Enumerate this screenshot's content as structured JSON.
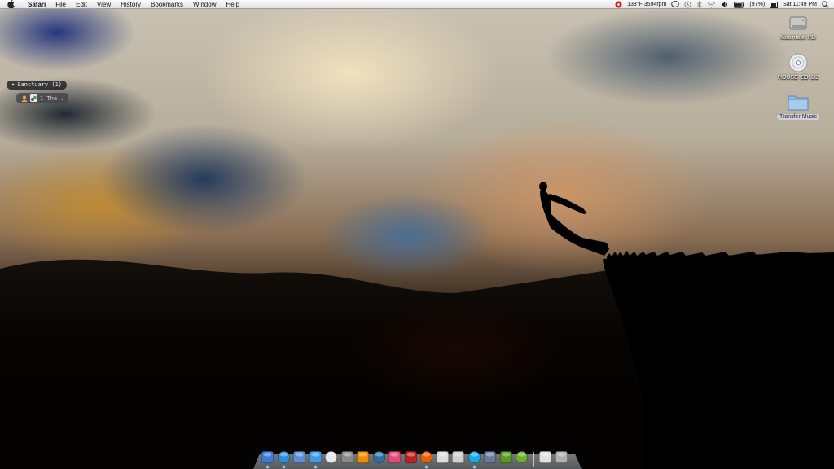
{
  "menubar": {
    "app_name": "Safari",
    "menus": [
      "File",
      "Edit",
      "View",
      "History",
      "Bookmarks",
      "Window",
      "Help"
    ],
    "status": {
      "temp_fan": "138°F 3594rpm",
      "battery": "(97%)",
      "clock": "Sat 11:49 PM"
    }
  },
  "desktop_icons": [
    {
      "label": "Macintosh HD",
      "icon": "hard-drive-icon"
    },
    {
      "label": "HOUSE_S3_D2",
      "icon": "disc-icon"
    },
    {
      "label": "Transfer Music",
      "icon": "folder-icon",
      "selected": true
    }
  ],
  "widget": {
    "title": "Sanctuary (1)",
    "item_text": "1 The.."
  },
  "dock": {
    "items": [
      {
        "name": "finder",
        "color": "#3a7bd5",
        "running": true
      },
      {
        "name": "safari",
        "color": "#2b8ce0",
        "running": true
      },
      {
        "name": "mail",
        "color": "#5b8fd6",
        "running": false
      },
      {
        "name": "itunes",
        "color": "#3f9be8",
        "running": true
      },
      {
        "name": "ical",
        "color": "#e8e8e8",
        "running": false
      },
      {
        "name": "system-preferences",
        "color": "#8a8a8a",
        "running": false
      },
      {
        "name": "vlc",
        "color": "#f08a00",
        "running": false
      },
      {
        "name": "adium",
        "color": "#2f6f9f",
        "running": false
      },
      {
        "name": "lastfm",
        "color": "#e24a7a",
        "running": false
      },
      {
        "name": "transmission",
        "color": "#c02020",
        "running": false
      },
      {
        "name": "firefox",
        "color": "#e66000",
        "running": true
      },
      {
        "name": "textedit",
        "color": "#dcdcdc",
        "running": false
      },
      {
        "name": "ipod",
        "color": "#d0d0d0",
        "running": false
      },
      {
        "name": "skype",
        "color": "#18a8e8",
        "running": true
      },
      {
        "name": "xcode",
        "color": "#6a7a9a",
        "running": false
      },
      {
        "name": "dreamweaver",
        "color": "#5a9a20",
        "running": false
      },
      {
        "name": "utorrent",
        "color": "#6ab030",
        "running": false
      },
      {
        "name": "documents",
        "color": "#e0e0e0",
        "running": false
      },
      {
        "name": "trash",
        "color": "#b0b0b0",
        "running": false
      }
    ]
  }
}
